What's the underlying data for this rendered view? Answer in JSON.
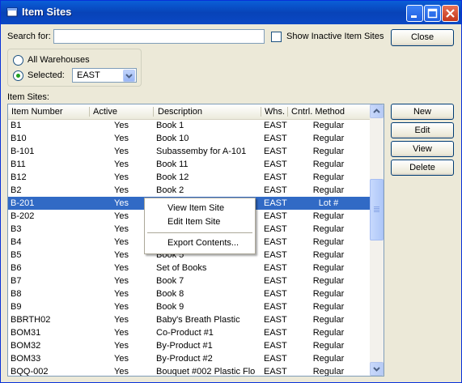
{
  "window": {
    "title": "Item Sites"
  },
  "search": {
    "label": "Search for:",
    "value": "",
    "show_inactive_label": "Show Inactive Item Sites",
    "show_inactive_checked": false
  },
  "buttons": {
    "close": "Close",
    "new": "New",
    "edit": "Edit",
    "view": "View",
    "delete": "Delete"
  },
  "warehouse": {
    "all_label": "All Warehouses",
    "selected_label": "Selected:",
    "selected_value": "EAST",
    "mode": "selected"
  },
  "list": {
    "label": "Item Sites:",
    "columns": [
      "Item Number",
      "Active",
      "Description",
      "Whs.",
      "Cntrl. Method"
    ],
    "selected_index": 6,
    "rows": [
      [
        "B1",
        "Yes",
        "Book 1",
        "EAST",
        "Regular"
      ],
      [
        "B10",
        "Yes",
        "Book 10",
        "EAST",
        "Regular"
      ],
      [
        "B-101",
        "Yes",
        "Subassemby for A-101",
        "EAST",
        "Regular"
      ],
      [
        "B11",
        "Yes",
        "Book 11",
        "EAST",
        "Regular"
      ],
      [
        "B12",
        "Yes",
        "Book 12",
        "EAST",
        "Regular"
      ],
      [
        "B2",
        "Yes",
        "Book 2",
        "EAST",
        "Regular"
      ],
      [
        "B-201",
        "Yes",
        "",
        "EAST",
        "Lot #"
      ],
      [
        "B-202",
        "Yes",
        "",
        "EAST",
        "Regular"
      ],
      [
        "B3",
        "Yes",
        "",
        "EAST",
        "Regular"
      ],
      [
        "B4",
        "Yes",
        "",
        "EAST",
        "Regular"
      ],
      [
        "B5",
        "Yes",
        "Book 5",
        "EAST",
        "Regular"
      ],
      [
        "B6",
        "Yes",
        "Set of Books",
        "EAST",
        "Regular"
      ],
      [
        "B7",
        "Yes",
        "Book 7",
        "EAST",
        "Regular"
      ],
      [
        "B8",
        "Yes",
        "Book 8",
        "EAST",
        "Regular"
      ],
      [
        "B9",
        "Yes",
        "Book 9",
        "EAST",
        "Regular"
      ],
      [
        "BBRTH02",
        "Yes",
        "Baby's Breath Plastic",
        "EAST",
        "Regular"
      ],
      [
        "BOM31",
        "Yes",
        "Co-Product #1",
        "EAST",
        "Regular"
      ],
      [
        "BOM32",
        "Yes",
        "By-Product #1",
        "EAST",
        "Regular"
      ],
      [
        "BOM33",
        "Yes",
        "By-Product #2",
        "EAST",
        "Regular"
      ],
      [
        "BQQ-002",
        "Yes",
        "Bouquet #002 Plastic Flo",
        "EAST",
        "Regular"
      ]
    ]
  },
  "context_menu": {
    "items": [
      "View Item Site",
      "Edit Item Site",
      "Export Contents..."
    ]
  }
}
